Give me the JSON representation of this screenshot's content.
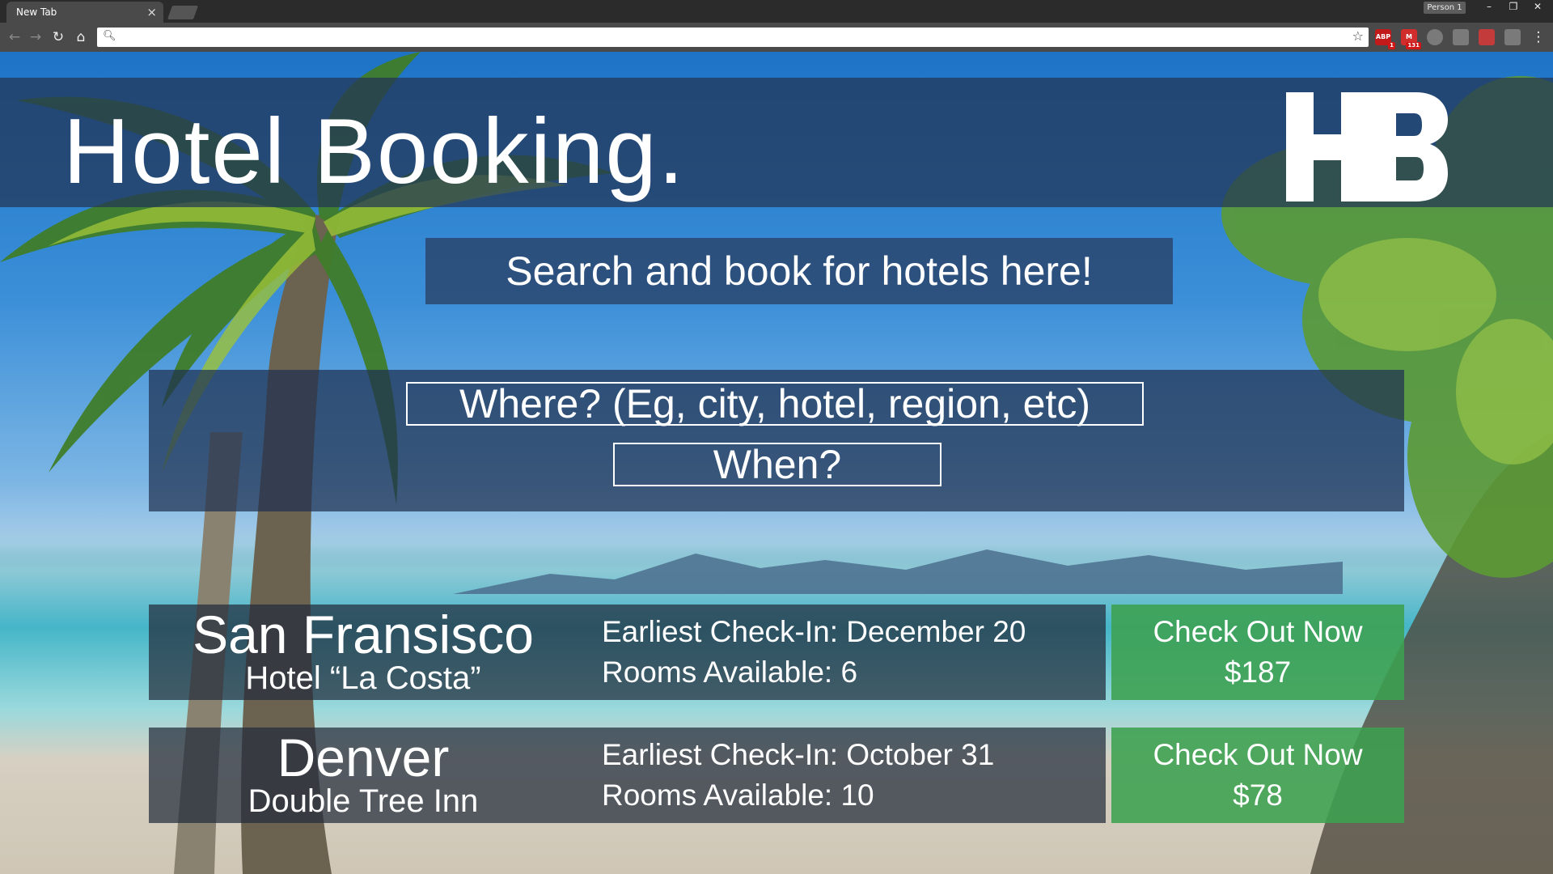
{
  "browser": {
    "tab_title": "New Tab",
    "tab_close": "×",
    "profile": "Person 1",
    "window_buttons": {
      "minimize": "–",
      "restore": "❐",
      "close": "✕"
    },
    "address_value": "",
    "extensions": [
      {
        "name": "adblock-plus",
        "label": "ABP",
        "badge": "1",
        "color": "#c21a1a"
      },
      {
        "name": "gmail-checker",
        "label": "M",
        "badge": "131",
        "color": "#d22d2d"
      },
      {
        "name": "extension-circle",
        "label": "",
        "badge": "",
        "color": "#7a7a7a"
      },
      {
        "name": "extension-camera",
        "label": "",
        "badge": "",
        "color": "#7a7a7a"
      },
      {
        "name": "extension-calendar",
        "label": "",
        "badge": "",
        "color": "#c43b3b"
      },
      {
        "name": "extension-grid",
        "label": "",
        "badge": "",
        "color": "#7a7a7a"
      }
    ]
  },
  "site": {
    "title": "Hotel Booking.",
    "logo_text": "HB",
    "tagline": "Search and book for hotels here!"
  },
  "search": {
    "where_placeholder": "Where? (Eg, city, hotel, region, etc)",
    "when_placeholder": "When?"
  },
  "listings": [
    {
      "city": "San Fransisco",
      "hotel": "Hotel “La Costa”",
      "checkin": "Earliest Check-In: December 20",
      "rooms": "Rooms Available: 6",
      "cta_label": "Check Out Now",
      "price": "$187"
    },
    {
      "city": "Denver",
      "hotel": "Double Tree Inn",
      "checkin": "Earliest Check-In: October 31",
      "rooms": "Rooms Available: 10",
      "cta_label": "Check Out Now",
      "price": "$78"
    }
  ],
  "colors": {
    "header_overlay": "#233455",
    "cta_green": "#3ca050",
    "listing_overlay": "#232d3c"
  }
}
